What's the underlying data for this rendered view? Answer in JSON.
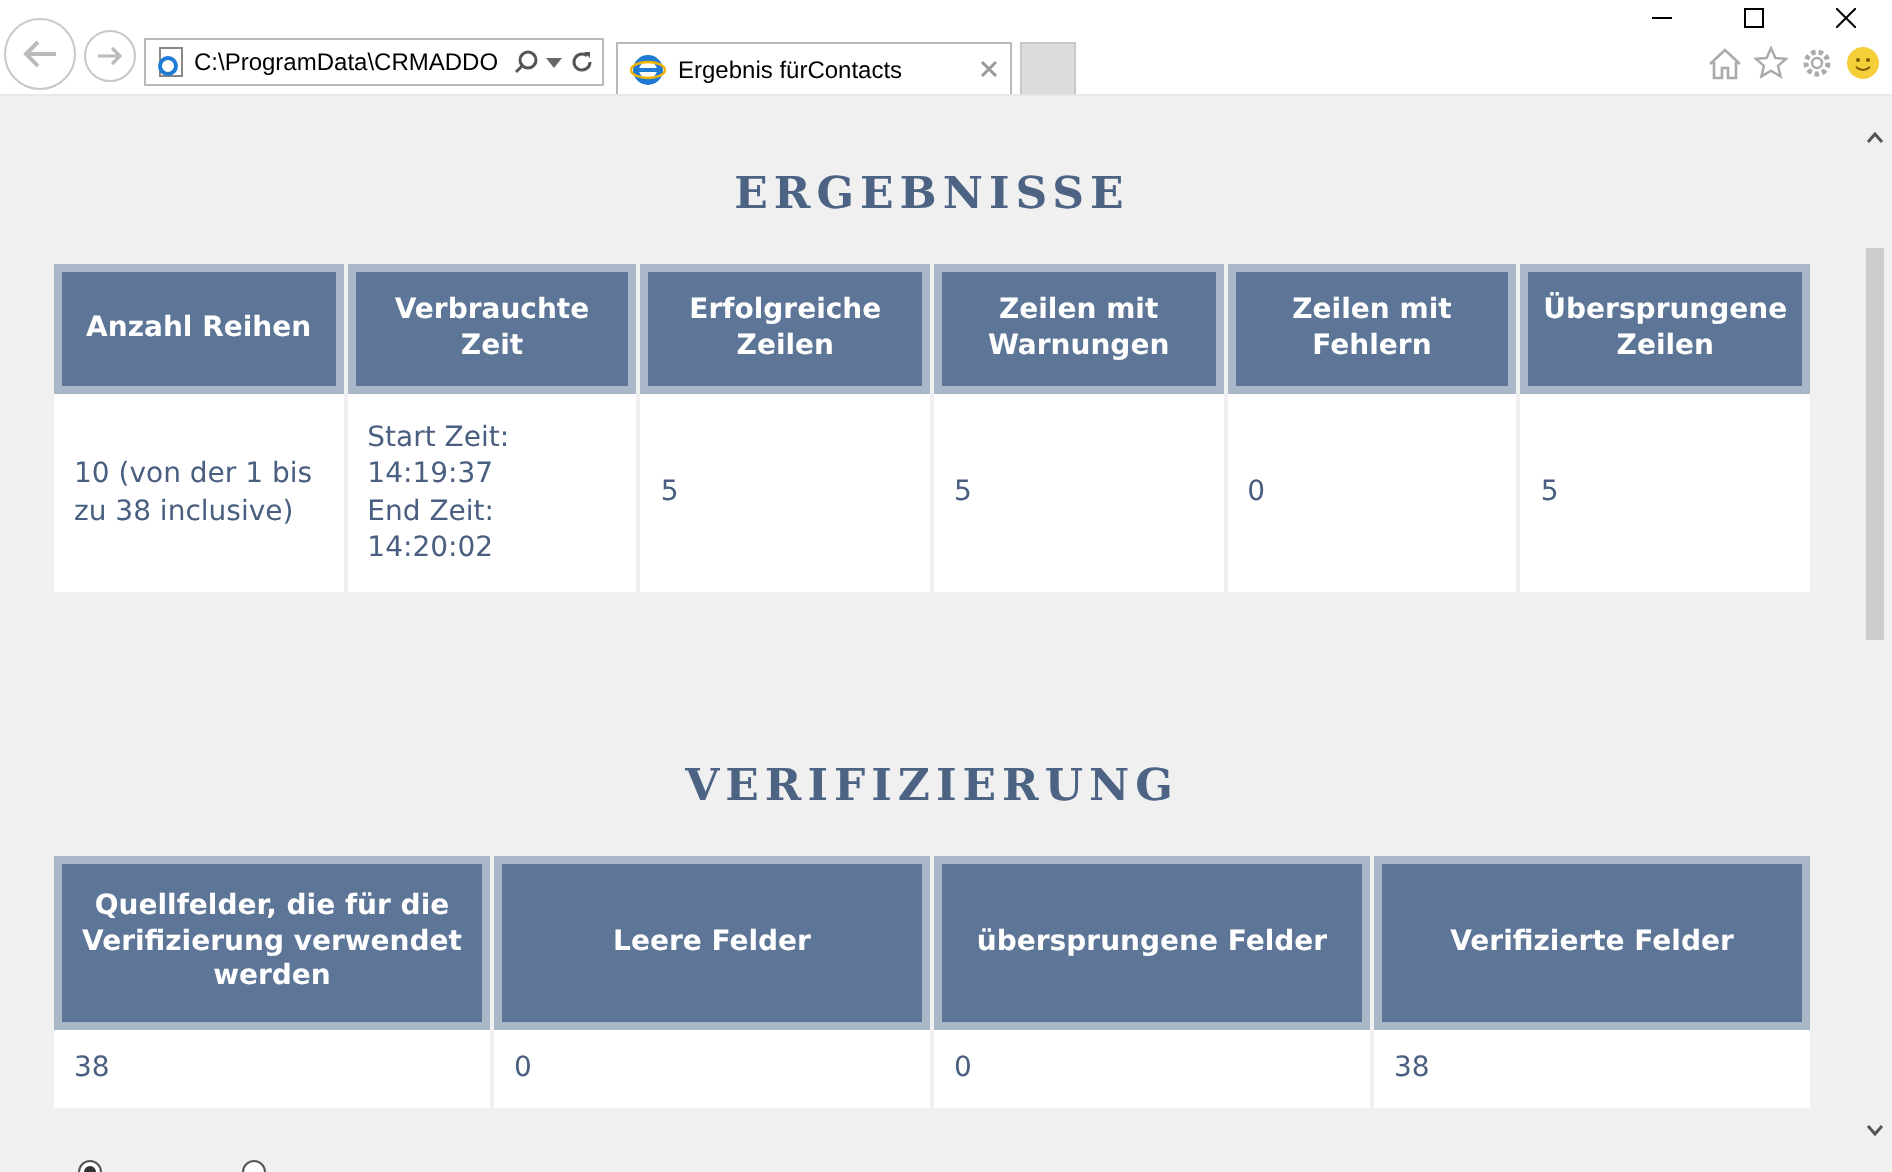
{
  "browser": {
    "address": "C:\\ProgramData\\CRMADDO",
    "tab": {
      "title": "Ergebnis fürContacts",
      "selected": true
    }
  },
  "sections": [
    {
      "title": "ERGEBNISSE",
      "columns": [
        "Anzahl Reihen",
        "Verbrauchte Zeit",
        "Erfolgreiche Zeilen",
        "Zeilen mit Warnungen",
        "Zeilen mit Fehlern",
        "Übersprungene Zeilen"
      ],
      "rows": [
        [
          "10 (von der 1 bis zu 38 inclusive)",
          "Start Zeit:\n14:19:37\nEnd Zeit:\n14:20:02",
          "5",
          "5",
          "0",
          "5"
        ]
      ]
    },
    {
      "title": "VERIFIZIERUNG",
      "columns": [
        "Quellfelder, die für die Verifizierung verwendet werden",
        "Leere Felder",
        "übersprungene Felder",
        "Verifizierte Felder"
      ],
      "rows": [
        [
          "38",
          "0",
          "0",
          "38"
        ]
      ]
    }
  ],
  "radios": [
    {
      "selected": true
    },
    {
      "selected": false
    }
  ]
}
